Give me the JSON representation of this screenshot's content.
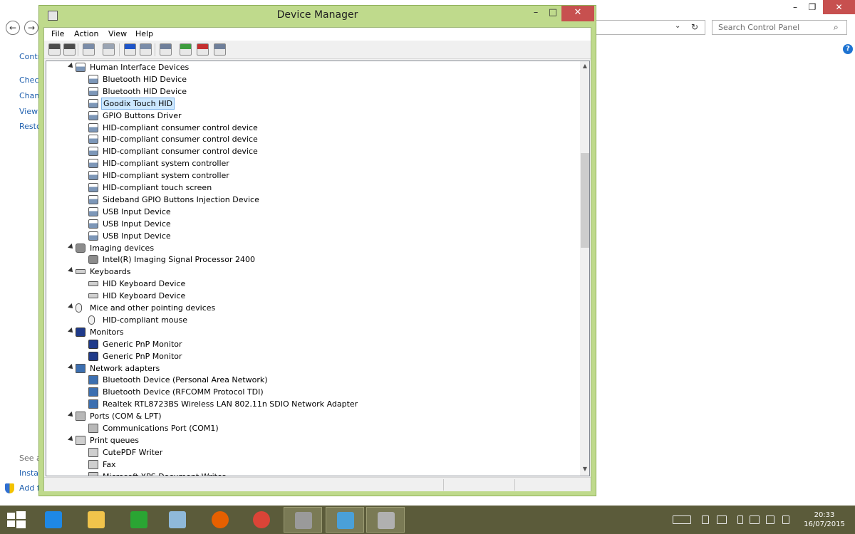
{
  "background_window": {
    "nav": {
      "back_icon": "back-arrow-icon",
      "forward_icon": "forward-arrow-icon"
    },
    "search_placeholder": "Search Control Panel",
    "window_controls": {
      "minimize": "–",
      "restore": "❐",
      "close": "✕"
    },
    "sidebar_fragments": [
      "Contr",
      "Check",
      "Chan",
      "View",
      "Resto"
    ],
    "bottom_fragments": [
      "See al",
      "Instal",
      "Add f"
    ],
    "help_label": "?"
  },
  "device_manager": {
    "title": "Device Manager",
    "window_controls": {
      "minimize": "–",
      "maximize": "□",
      "close": "✕"
    },
    "menu": [
      "File",
      "Action",
      "View",
      "Help"
    ],
    "toolbar": [
      "back-icon",
      "forward-icon",
      "show-hide-console-tree-icon",
      "properties-icon",
      "help-icon",
      "action-pane-icon",
      "scan-hardware-icon",
      "update-driver-icon",
      "uninstall-icon",
      "disable-icon"
    ],
    "tree": [
      {
        "type": "category",
        "label": "Human Interface Devices",
        "icon": "hid",
        "expanded": true
      },
      {
        "type": "device",
        "label": "Bluetooth HID Device",
        "icon": "hid"
      },
      {
        "type": "device",
        "label": "Bluetooth HID Device",
        "icon": "hid"
      },
      {
        "type": "device",
        "label": "Goodix Touch HID",
        "icon": "hid",
        "selected": true
      },
      {
        "type": "device",
        "label": "GPIO Buttons Driver",
        "icon": "hid"
      },
      {
        "type": "device",
        "label": "HID-compliant consumer control device",
        "icon": "hid"
      },
      {
        "type": "device",
        "label": "HID-compliant consumer control device",
        "icon": "hid"
      },
      {
        "type": "device",
        "label": "HID-compliant consumer control device",
        "icon": "hid"
      },
      {
        "type": "device",
        "label": "HID-compliant system controller",
        "icon": "hid"
      },
      {
        "type": "device",
        "label": "HID-compliant system controller",
        "icon": "hid"
      },
      {
        "type": "device",
        "label": "HID-compliant touch screen",
        "icon": "hid"
      },
      {
        "type": "device",
        "label": "Sideband GPIO Buttons Injection Device",
        "icon": "hid"
      },
      {
        "type": "device",
        "label": "USB Input Device",
        "icon": "hid"
      },
      {
        "type": "device",
        "label": "USB Input Device",
        "icon": "hid"
      },
      {
        "type": "device",
        "label": "USB Input Device",
        "icon": "hid"
      },
      {
        "type": "category",
        "label": "Imaging devices",
        "icon": "cam",
        "expanded": true
      },
      {
        "type": "device",
        "label": "Intel(R) Imaging Signal Processor 2400",
        "icon": "cam"
      },
      {
        "type": "category",
        "label": "Keyboards",
        "icon": "kb",
        "expanded": true
      },
      {
        "type": "device",
        "label": "HID Keyboard Device",
        "icon": "kb"
      },
      {
        "type": "device",
        "label": "HID Keyboard Device",
        "icon": "kb"
      },
      {
        "type": "category",
        "label": "Mice and other pointing devices",
        "icon": "mouse",
        "expanded": true
      },
      {
        "type": "device",
        "label": "HID-compliant mouse",
        "icon": "mouse"
      },
      {
        "type": "category",
        "label": "Monitors",
        "icon": "mon",
        "expanded": true
      },
      {
        "type": "device",
        "label": "Generic PnP Monitor",
        "icon": "mon"
      },
      {
        "type": "device",
        "label": "Generic PnP Monitor",
        "icon": "mon"
      },
      {
        "type": "category",
        "label": "Network adapters",
        "icon": "net",
        "expanded": true
      },
      {
        "type": "device",
        "label": "Bluetooth Device (Personal Area Network)",
        "icon": "net"
      },
      {
        "type": "device",
        "label": "Bluetooth Device (RFCOMM Protocol TDI)",
        "icon": "net"
      },
      {
        "type": "device",
        "label": "Realtek RTL8723BS Wireless LAN 802.11n SDIO Network Adapter",
        "icon": "net"
      },
      {
        "type": "category",
        "label": "Ports (COM & LPT)",
        "icon": "port",
        "expanded": true
      },
      {
        "type": "device",
        "label": "Communications Port (COM1)",
        "icon": "port"
      },
      {
        "type": "category",
        "label": "Print queues",
        "icon": "print",
        "expanded": true
      },
      {
        "type": "device",
        "label": "CutePDF Writer",
        "icon": "print"
      },
      {
        "type": "device",
        "label": "Fax",
        "icon": "print"
      },
      {
        "type": "device",
        "label": "Microsoft XPS Document Writer",
        "icon": "print"
      }
    ],
    "scrollbar": {
      "up_icon": "▲",
      "down_icon": "▼"
    }
  },
  "taskbar": {
    "start_icon": "windows-start-icon",
    "apps": [
      {
        "name": "internet-explorer-icon",
        "color": "#1e88e5",
        "active": false
      },
      {
        "name": "file-explorer-icon",
        "color": "#f1c44b",
        "active": false
      },
      {
        "name": "store-icon",
        "color": "#2aa533",
        "active": false
      },
      {
        "name": "notepad-icon",
        "color": "#8fb9d9",
        "active": false
      },
      {
        "name": "firefox-icon",
        "color": "#e66000",
        "active": false
      },
      {
        "name": "chrome-icon",
        "color": "#db4437",
        "active": false
      },
      {
        "name": "device-manager-icon",
        "color": "#9a9a9a",
        "active": true
      },
      {
        "name": "control-panel-icon",
        "color": "#4aa0d8",
        "active": true
      },
      {
        "name": "device-manager-icon",
        "color": "#b0b0b0",
        "active": true
      }
    ],
    "tray_icons": [
      "keyboard-icon",
      "bluetooth-icon",
      "network-icon",
      "battery-icon",
      "signal-icon",
      "volume-icon",
      "flag-icon"
    ],
    "time": "20:33",
    "date": "16/07/2015"
  }
}
